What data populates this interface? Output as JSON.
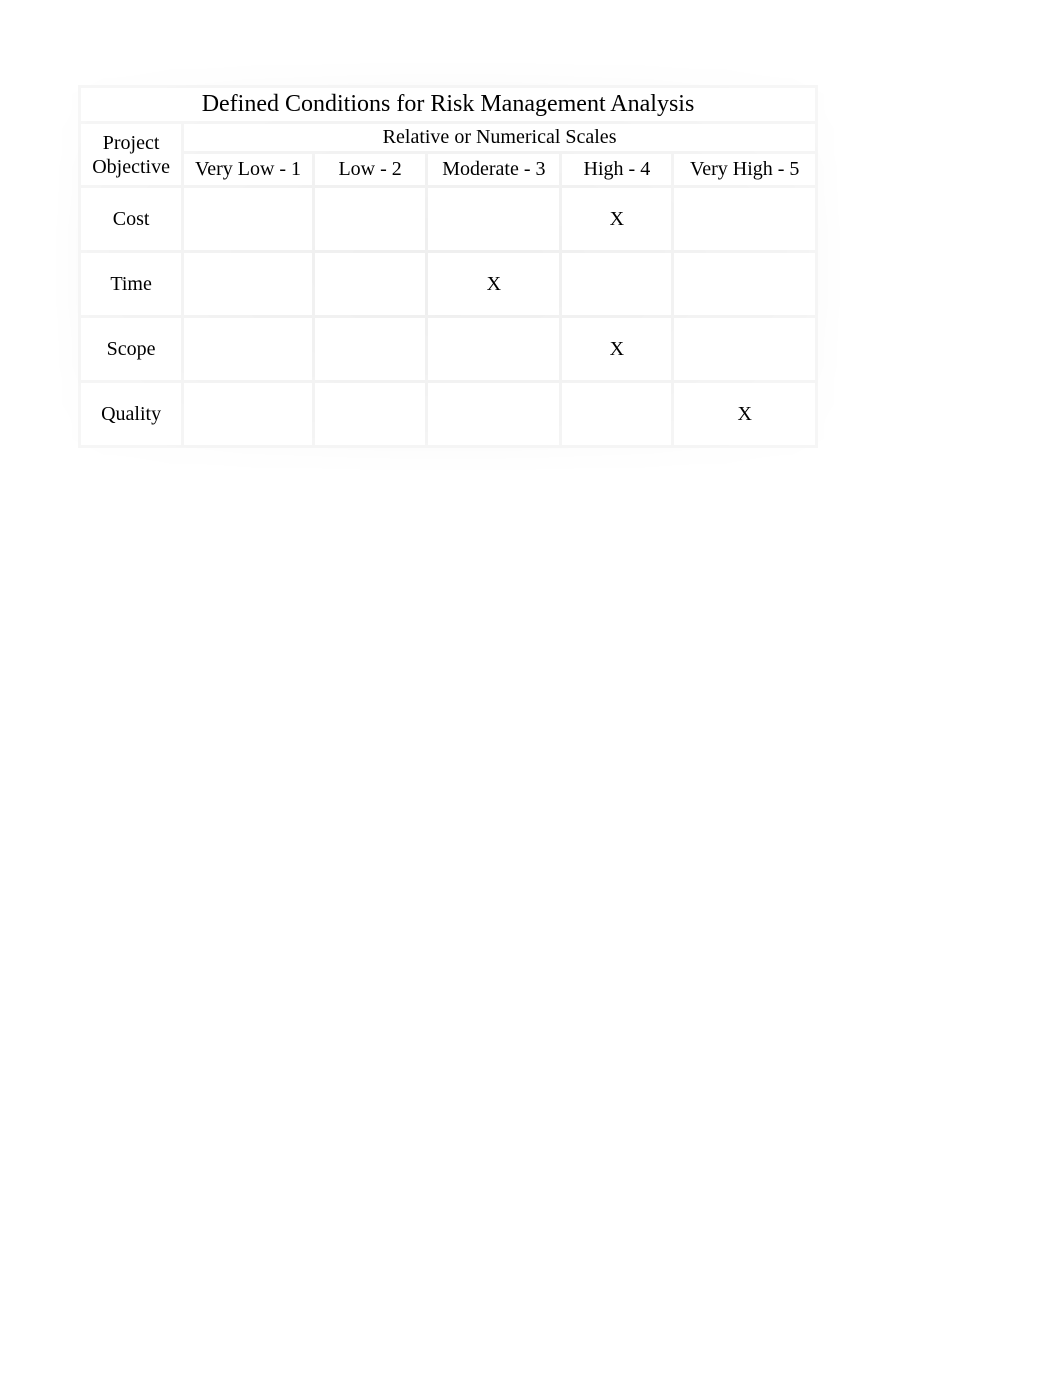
{
  "table": {
    "title": "Defined Conditions for Risk Management Analysis",
    "objective_header_line1": "Project",
    "objective_header_line2": "Objective",
    "scales_header": "Relative or Numerical Scales",
    "scale_labels": [
      "Very Low - 1",
      "Low - 2",
      "Moderate - 3",
      "High - 4",
      "Very High - 5"
    ],
    "mark": "X",
    "rows": [
      {
        "label": "Cost",
        "marks": [
          "",
          "",
          "",
          "X",
          ""
        ]
      },
      {
        "label": "Time",
        "marks": [
          "",
          "",
          "X",
          "",
          ""
        ]
      },
      {
        "label": "Scope",
        "marks": [
          "",
          "",
          "",
          "X",
          ""
        ]
      },
      {
        "label": "Quality",
        "marks": [
          "",
          "",
          "",
          "",
          "X"
        ]
      }
    ]
  }
}
